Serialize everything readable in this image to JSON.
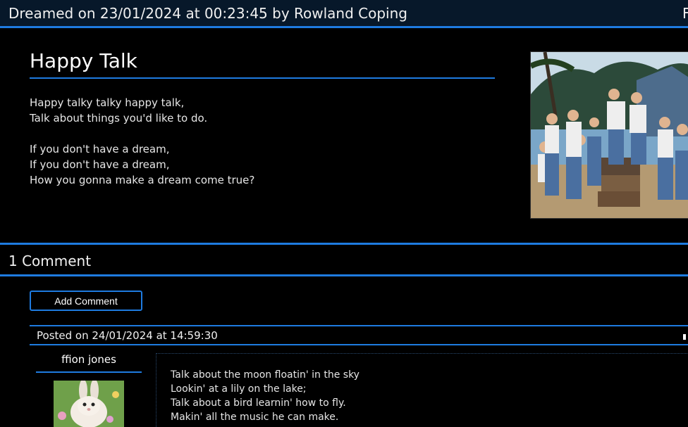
{
  "header": {
    "title": "Dreamed on 23/01/2024 at 00:23:45 by Rowland Coping",
    "right_cut": "F"
  },
  "dream": {
    "title": "Happy Talk",
    "stanzas": [
      [
        "Happy talky talky happy talk,",
        "Talk about things you'd like to do."
      ],
      [
        "If you don't have a dream,",
        "If you don't have a dream,",
        "How you gonna make a dream come true?"
      ]
    ],
    "image": {
      "desc_icon": "photo-sailors-on-beach"
    }
  },
  "comments": {
    "title": "1 Comment",
    "add_button": "Add Comment",
    "items": [
      {
        "posted": "Posted on 24/01/2024 at 14:59:30",
        "author": "ffion jones",
        "avatar_icon": "bunny-avatar",
        "lines": [
          "Talk about the moon floatin' in the sky",
          "Lookin' at a lily on the lake;",
          "Talk about a bird learnin' how to fly.",
          "Makin' all the music he can make."
        ]
      }
    ]
  },
  "colors": {
    "accent": "#1e7be0",
    "header_bg": "#07182a",
    "background": "#000000"
  }
}
